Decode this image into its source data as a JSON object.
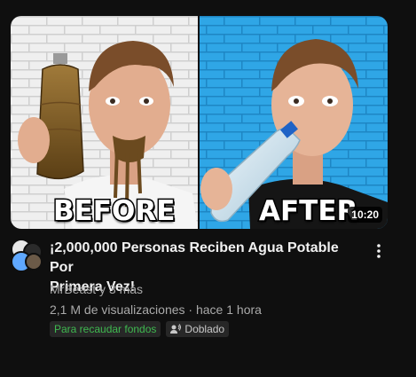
{
  "video": {
    "title_line1": "¡2,000,000 Personas Reciben Agua Potable Por",
    "title_line2": "Primera Vez!",
    "channel": "MrBeast y 3 más",
    "views": "2,1 M de visualizaciones",
    "separator": "·",
    "uploaded": "hace 1 hora",
    "duration": "10:20",
    "badges": {
      "fundraiser": "Para recaudar fondos",
      "dubbed": "Doblado"
    }
  },
  "thumbnail": {
    "label_left": "BEFORE",
    "label_right": "AFTER"
  },
  "icons": {
    "more": "vertical-ellipsis-icon",
    "dubbed": "dubbed-audio-icon"
  },
  "colors": {
    "background": "#0f0f0f",
    "fundraiser_badge_text": "#3fb950",
    "secondary_text": "#aaaaaa",
    "left_panel_wall": "#f2f2f2",
    "right_panel_wall": "#2fa6e6"
  }
}
